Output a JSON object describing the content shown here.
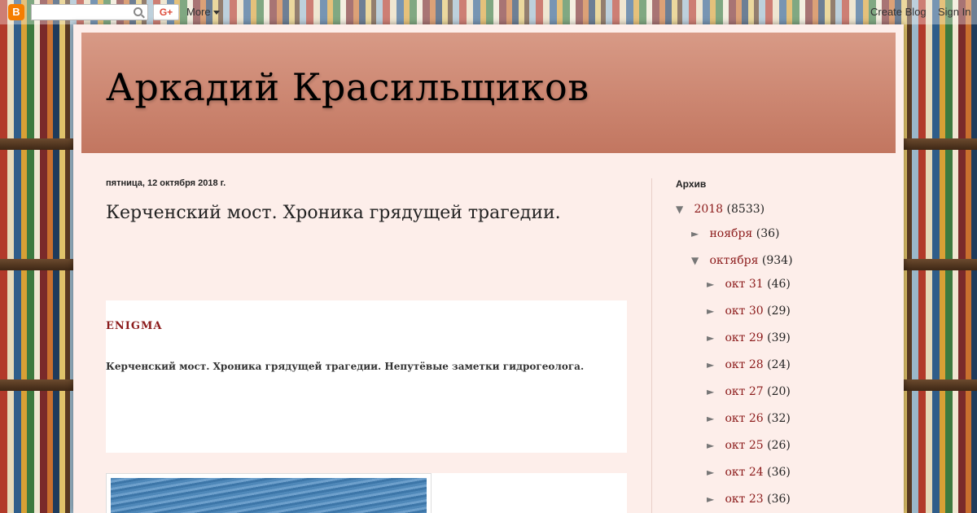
{
  "navbar": {
    "logo_glyph": "B",
    "gplus_label": "G+",
    "more_label": "More",
    "create_blog_label": "Create Blog",
    "sign_in_label": "Sign In"
  },
  "blog": {
    "title": "Аркадий Красильщиков"
  },
  "post": {
    "date": "пятница, 12 октября 2018 г.",
    "title": "Керченский мост. Хроника грядущей трагедии.",
    "source_label": "ENIGMA",
    "subtitle": "Керченский мост. Хроника грядущей трагедии. Непутёвые заметки гидрогеолога."
  },
  "sidebar": {
    "archive_title": "Архив",
    "archive": [
      {
        "toggle": "▼",
        "label": "2018",
        "count": "(8533)"
      },
      {
        "toggle": "►",
        "label": "ноября",
        "count": "(36)"
      },
      {
        "toggle": "▼",
        "label": "октября",
        "count": "(934)"
      },
      {
        "toggle": "►",
        "label": "окт 31",
        "count": "(46)"
      },
      {
        "toggle": "►",
        "label": "окт 30",
        "count": "(29)"
      },
      {
        "toggle": "►",
        "label": "окт 29",
        "count": "(39)"
      },
      {
        "toggle": "►",
        "label": "окт 28",
        "count": "(24)"
      },
      {
        "toggle": "►",
        "label": "окт 27",
        "count": "(20)"
      },
      {
        "toggle": "►",
        "label": "окт 26",
        "count": "(32)"
      },
      {
        "toggle": "►",
        "label": "окт 25",
        "count": "(26)"
      },
      {
        "toggle": "►",
        "label": "окт 24",
        "count": "(36)"
      },
      {
        "toggle": "►",
        "label": "окт 23",
        "count": "(36)"
      }
    ]
  },
  "colors": {
    "link": "#8b1a1a",
    "page_background": "#fdeeea",
    "header_top": "#d89a86",
    "header_bottom": "#c27660"
  }
}
